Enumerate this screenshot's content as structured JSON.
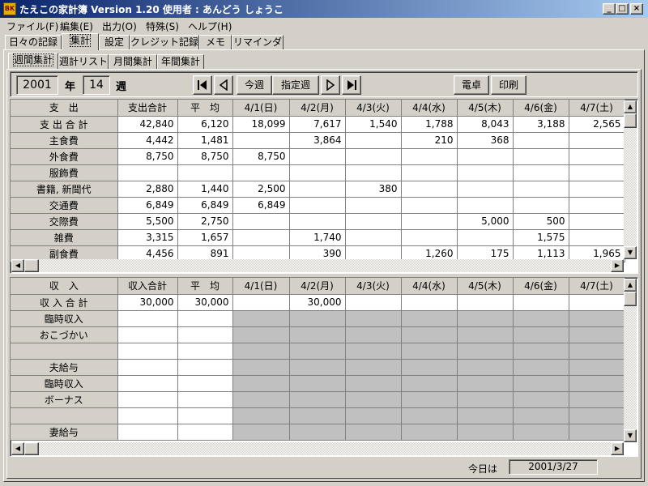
{
  "window": {
    "title": "たえこの家計簿  Version 1.20   使用者 : あんどう  しょうこ",
    "icon_text": "BK"
  },
  "menu": [
    "ファイル(F)",
    "編集(E)",
    "出力(O)",
    "特殊(S)",
    "ヘルプ(H)"
  ],
  "main_tabs": [
    "日々の記録",
    "集計",
    "設定",
    "クレジット記録",
    "メモ",
    "リマインダ"
  ],
  "main_tab_active": "集計",
  "sub_tabs": [
    "週間集計",
    "週計リスト",
    "月間集計",
    "年間集計"
  ],
  "sub_tab_active": "週間集計",
  "toolbar": {
    "year": "2001",
    "year_label": "年",
    "week": "14",
    "week_label": "週",
    "this_week": "今週",
    "select_week": "指定週",
    "calculator": "電卓",
    "print": "印刷"
  },
  "expense": {
    "headers": [
      "支　出",
      "支出合計",
      "平　均",
      "4/1(日)",
      "4/2(月)",
      "4/3(火)",
      "4/4(水)",
      "4/5(木)",
      "4/6(金)",
      "4/7(土)"
    ],
    "rows": [
      [
        "支 出 合 計",
        "42,840",
        "6,120",
        "18,099",
        "7,617",
        "1,540",
        "1,788",
        "8,043",
        "3,188",
        "2,565"
      ],
      [
        "主食費",
        "4,442",
        "1,481",
        "",
        "3,864",
        "",
        "210",
        "368",
        "",
        ""
      ],
      [
        "外食費",
        "8,750",
        "8,750",
        "8,750",
        "",
        "",
        "",
        "",
        "",
        ""
      ],
      [
        "服飾費",
        "",
        "",
        "",
        "",
        "",
        "",
        "",
        "",
        ""
      ],
      [
        "書籍, 新聞代",
        "2,880",
        "1,440",
        "2,500",
        "",
        "380",
        "",
        "",
        "",
        ""
      ],
      [
        "交通費",
        "6,849",
        "6,849",
        "6,849",
        "",
        "",
        "",
        "",
        "",
        ""
      ],
      [
        "交際費",
        "5,500",
        "2,750",
        "",
        "",
        "",
        "",
        "5,000",
        "500",
        ""
      ],
      [
        "雑費",
        "3,315",
        "1,657",
        "",
        "1,740",
        "",
        "",
        "",
        "1,575",
        ""
      ],
      [
        "副食費",
        "4,456",
        "891",
        "",
        "390",
        "",
        "1,260",
        "175",
        "1,113",
        "1,965"
      ]
    ]
  },
  "income": {
    "headers": [
      "収　入",
      "収入合計",
      "平　均",
      "4/1(日)",
      "4/2(月)",
      "4/3(火)",
      "4/4(水)",
      "4/5(木)",
      "4/6(金)",
      "4/7(土)"
    ],
    "rows": [
      [
        "収 入 合 計",
        "30,000",
        "30,000",
        "",
        "30,000",
        "",
        "",
        "",
        "",
        ""
      ],
      [
        "臨時収入",
        "",
        "",
        "",
        "",
        "",
        "",
        "",
        "",
        ""
      ],
      [
        "おこづかい",
        "",
        "",
        "",
        "",
        "",
        "",
        "",
        "",
        ""
      ],
      [
        "",
        "",
        "",
        "",
        "",
        "",
        "",
        "",
        "",
        ""
      ],
      [
        "夫給与",
        "",
        "",
        "",
        "",
        "",
        "",
        "",
        "",
        ""
      ],
      [
        "臨時収入",
        "",
        "",
        "",
        "",
        "",
        "",
        "",
        "",
        ""
      ],
      [
        "ボーナス",
        "",
        "",
        "",
        "",
        "",
        "",
        "",
        "",
        ""
      ],
      [
        "",
        "",
        "",
        "",
        "",
        "",
        "",
        "",
        "",
        ""
      ],
      [
        "妻給与",
        "",
        "",
        "",
        "",
        "",
        "",
        "",
        "",
        ""
      ]
    ]
  },
  "status": {
    "today_label": "今日は",
    "today_value": "2001/3/27"
  },
  "colors": {
    "title_start": "#0a246a",
    "title_end": "#a6caf0",
    "face": "#d4d0c8",
    "income_empty_cell": "#c0c0c0"
  }
}
